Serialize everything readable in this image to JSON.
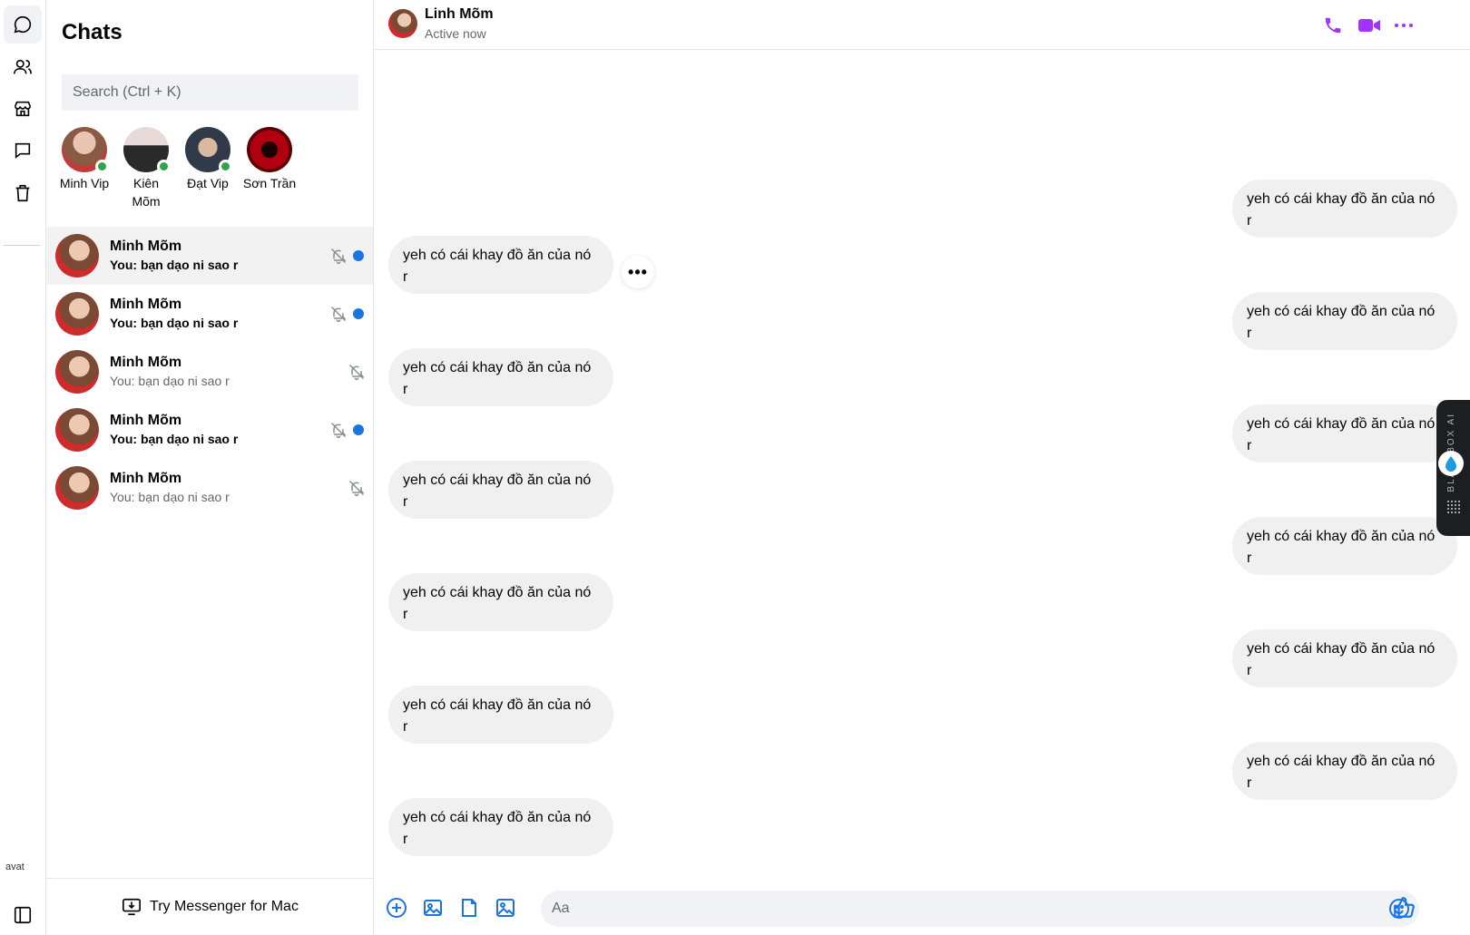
{
  "sidebar_rail": {
    "items": [
      "chats-icon",
      "people-icon",
      "marketplace-icon",
      "requests-icon",
      "archive-icon"
    ],
    "avatar_alt": "avat",
    "bottom": "sidebar-toggle-icon"
  },
  "chats": {
    "title": "Chats",
    "search_placeholder": "Search (Ctrl + K)",
    "stories": [
      {
        "name": "Minh Vip",
        "online": true,
        "color": "#c9a28c"
      },
      {
        "name": "Kiên Mõm",
        "online": true,
        "color": "#d8c7c7"
      },
      {
        "name": "Đạt Vip",
        "online": true,
        "color": "#6b7a8c"
      },
      {
        "name": "Sơn Trần",
        "online": false,
        "color": "#8b0000"
      }
    ],
    "conversations": [
      {
        "name": "Minh Mõm",
        "preview": "You: bạn dạo ni sao r",
        "unread": true,
        "muted": true,
        "selected": true
      },
      {
        "name": "Minh Mõm",
        "preview": "You: bạn dạo ni sao r",
        "unread": true,
        "muted": true,
        "selected": false
      },
      {
        "name": "Minh Mõm",
        "preview": "You: bạn dạo ni sao r",
        "unread": false,
        "muted": true,
        "selected": false
      },
      {
        "name": "Minh Mõm",
        "preview": "You: bạn dạo ni sao r",
        "unread": true,
        "muted": true,
        "selected": false
      },
      {
        "name": "Minh Mõm",
        "preview": "You: bạn dạo ni sao r",
        "unread": false,
        "muted": true,
        "selected": false
      }
    ],
    "try_mac": "Try Messenger for Mac"
  },
  "thread": {
    "name": "Linh Mõm",
    "status": "Active now",
    "accent": "#a033ff",
    "messages": [
      {
        "side": "out",
        "line1": "yeh có cái khay đồ ăn của nó",
        "line2": "r"
      },
      {
        "side": "in",
        "line1": "yeh có cái khay đồ ăn của nó",
        "line2": "r"
      },
      {
        "side": "out",
        "line1": "yeh có cái khay đồ ăn của nó",
        "line2": "r"
      },
      {
        "side": "in",
        "line1": "yeh có cái khay đồ ăn của nó",
        "line2": "r"
      },
      {
        "side": "out",
        "line1": "yeh có cái khay đồ ăn của nó",
        "line2": "r"
      },
      {
        "side": "in",
        "line1": "yeh có cái khay đồ ăn của nó",
        "line2": "r"
      },
      {
        "side": "out",
        "line1": "yeh có cái khay đồ ăn của nó",
        "line2": "r"
      },
      {
        "side": "in",
        "line1": "yeh có cái khay đồ ăn của nó",
        "line2": "r"
      },
      {
        "side": "out",
        "line1": "yeh có cái khay đồ ăn của nó",
        "line2": "r"
      },
      {
        "side": "in",
        "line1": "yeh có cái khay đồ ăn của nó",
        "line2": "r"
      },
      {
        "side": "out",
        "line1": "yeh có cái khay đồ ăn của nó",
        "line2": "r"
      },
      {
        "side": "in",
        "line1": "yeh có cái khay đồ ăn của nó",
        "line2": "r"
      }
    ],
    "more_label": "•••",
    "composer_placeholder": "Aa"
  },
  "sidekick": {
    "label": "BLACKBOX AI"
  }
}
